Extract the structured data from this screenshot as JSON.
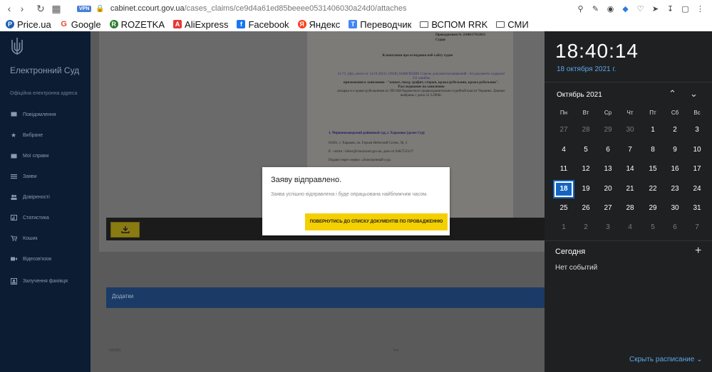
{
  "browser": {
    "url_host": "cabinet.ccourt.gov.ua",
    "url_path": "/cases_claims/ce9d4a61ed85beeee0531406030a24d0/attaches",
    "vpn_label": "VPN",
    "icons": [
      "back-icon",
      "forward-icon",
      "reload-icon",
      "grid-icon",
      "lock-icon"
    ],
    "bookmarks": [
      {
        "label": "Price.ua",
        "color": "#1f5fb0"
      },
      {
        "label": "Google",
        "color": "#ea4335"
      },
      {
        "label": "ROZETKA",
        "color": "#2e7d32"
      },
      {
        "label": "AliExpress",
        "color": "#e53935"
      },
      {
        "label": "Facebook",
        "color": "#1877f2"
      },
      {
        "label": "Яндекс",
        "color": "#fc3f1d"
      },
      {
        "label": "Переводчик",
        "color": "#4285f4"
      },
      {
        "label": "ВСПОМ RRK",
        "color": "#555555"
      },
      {
        "label": "СМИ",
        "color": "#555555"
      }
    ]
  },
  "sidebar": {
    "title": "Електронний Суд",
    "subtitle": "Офіційна електронна адреса",
    "items": [
      {
        "label": "Повідомлення",
        "icon": "message-icon"
      },
      {
        "label": "Вибране",
        "icon": "star-icon"
      },
      {
        "label": "Мої справи",
        "icon": "folder-icon"
      },
      {
        "label": "Заяви",
        "icon": "list-icon"
      },
      {
        "label": "Довіреності",
        "icon": "users-icon"
      },
      {
        "label": "Статистика",
        "icon": "chart-icon"
      },
      {
        "label": "Кошик",
        "icon": "cart-icon"
      },
      {
        "label": "Відеозв'язок",
        "icon": "video-icon"
      },
      {
        "label": "Залучення фахівця",
        "icon": "specialist-icon"
      }
    ]
  },
  "document": {
    "header_line1": "Провадження № 2/646/176/2021",
    "header_line2": "Судця",
    "heading": "Клопотання про огляданки веб-сайту судом",
    "para": "21-72_lipis_alexei от 14.10.2021г. (3928) ЗАЯВЛЕНИЕ Список документов/заявлений - 64 документа содержат 311 ошибок",
    "para2": "приложения к заявлению - \"копыт, гвозд, графит, стержн, кража рубельник, кража рубельник\". Расследование по заявлению",
    "para3": "штырка и о краже рубельников из ЛП-848 бюджетного правоохранительно-судебной власти Украины. Данные выбраны с даты 22.3.2006г.",
    "court_line": "1. Червонозаводский районный суд, г. Харькова (далее Суд)",
    "addr_line": "61001, г. Харьков, пл. Героев Небесной Сотни, 36, 3",
    "email_line": "Е - почта : inbox@cha.kcourt.gov.ua, дело от 646/7533/17",
    "via_line": "Подано через сервис «Электронный суд»"
  },
  "additions": {
    "title": "Додатки",
    "col_name": "НАЗВА",
    "col_type": "Тип"
  },
  "modal": {
    "title": "Заяву відправлено.",
    "text": "Заява успішно відправлена і буде опрацьована найближчим часом.",
    "button": "ПОВЕРНУТИСЬ ДО СПИСКУ ДОКУМЕНТІВ ПО ПРОВАДЖЕННЮ"
  },
  "calendar": {
    "time": "18:40:14",
    "date": "18 октября 2021 г.",
    "month": "Октябрь 2021",
    "weekdays": [
      "Пн",
      "Вт",
      "Ср",
      "Чт",
      "Пт",
      "Сб",
      "Вс"
    ],
    "weeks": [
      [
        "27",
        "28",
        "29",
        "30",
        "1",
        "2",
        "3"
      ],
      [
        "4",
        "5",
        "6",
        "7",
        "8",
        "9",
        "10"
      ],
      [
        "11",
        "12",
        "13",
        "14",
        "15",
        "16",
        "17"
      ],
      [
        "18",
        "19",
        "20",
        "21",
        "22",
        "23",
        "24"
      ],
      [
        "25",
        "26",
        "27",
        "28",
        "29",
        "30",
        "31"
      ],
      [
        "1",
        "2",
        "3",
        "4",
        "5",
        "6",
        "7"
      ]
    ],
    "today_label": "Сегодня",
    "no_events": "Нет событий",
    "hide_schedule": "Скрыть расписание",
    "accent": "#1565c0"
  }
}
